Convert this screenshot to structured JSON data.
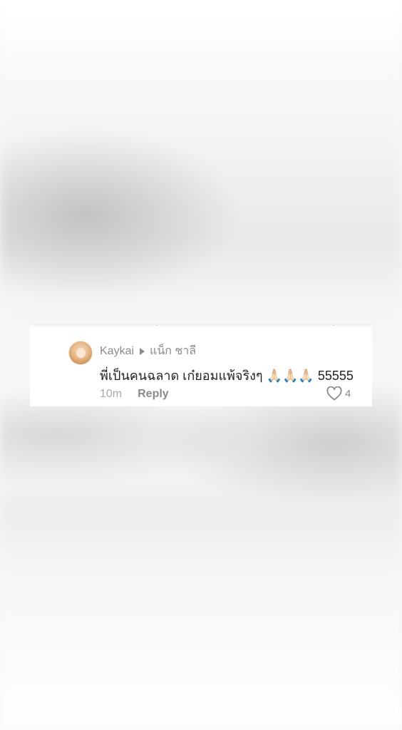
{
  "comment": {
    "username": "Kaykai",
    "reply_to": "แน็ก ชาลี",
    "text": "พี่เป็นคนฉลาด เก๋ยอมแพ้จริงๆ 🙏🏻🙏🏻🙏🏻 55555",
    "time": "10m",
    "reply_label": "Reply",
    "like_count": "4"
  },
  "icons": {
    "reply_to_arrow": "right-triangle-icon",
    "like": "heart-outline-icon"
  },
  "colors": {
    "card_background": "#ffffff",
    "muted_text": "#8a8a8a",
    "body_text": "#222222"
  }
}
